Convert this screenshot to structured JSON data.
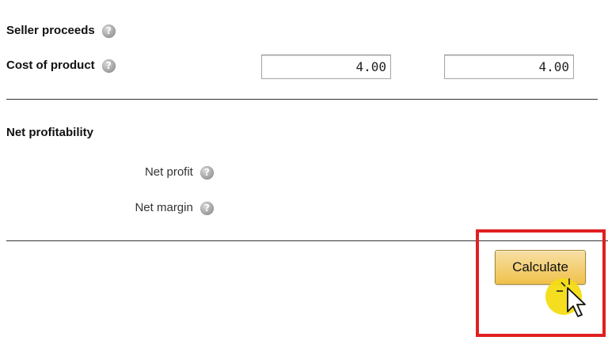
{
  "rows": {
    "seller_proceeds": {
      "label": "Seller proceeds"
    },
    "cost_of_product": {
      "label": "Cost of product",
      "value_left": "4.00",
      "value_right": "4.00"
    }
  },
  "net_profitability": {
    "heading": "Net profitability",
    "net_profit_label": "Net profit",
    "net_margin_label": "Net margin"
  },
  "help_icon_glyph": "?",
  "calculate_button": {
    "label": "Calculate"
  },
  "colors": {
    "button_gradient_top": "#f7dfa5",
    "button_gradient_bottom": "#f0c14b",
    "highlight": "#e02020",
    "cursor_halo": "#f4dc14"
  },
  "icons": {
    "help": "help-icon",
    "cursor": "arrow-cursor-icon"
  }
}
